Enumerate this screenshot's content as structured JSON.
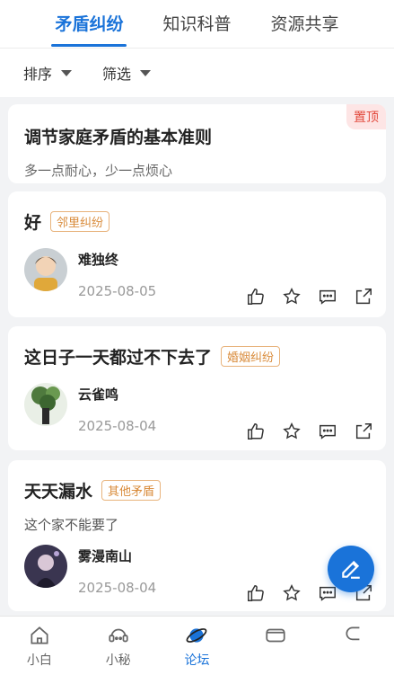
{
  "tabs": [
    {
      "label": "矛盾纠纷",
      "active": true
    },
    {
      "label": "知识科普",
      "active": false
    },
    {
      "label": "资源共享",
      "active": false
    }
  ],
  "filters": {
    "sort_label": "排序",
    "filter_label": "筛选"
  },
  "pinned": {
    "title": "调节家庭矛盾的基本准则",
    "subtitle": "多一点耐心，少一点烦心",
    "badge": "置顶"
  },
  "posts": [
    {
      "title": "好",
      "tag": "邻里纠纷",
      "body": "",
      "author": "难独终",
      "date": "2025-08-05"
    },
    {
      "title": "这日子一天都过不下去了",
      "tag": "婚姻纠纷",
      "body": "",
      "author": "云雀鸣",
      "date": "2025-08-04"
    },
    {
      "title": "天天漏水",
      "tag": "其他矛盾",
      "body": "这个家不能要了",
      "author": "雾漫南山",
      "date": "2025-08-04"
    }
  ],
  "bottom_nav": [
    {
      "label": "小白",
      "icon": "home-icon"
    },
    {
      "label": "小秘",
      "icon": "assistant-icon"
    },
    {
      "label": "论坛",
      "icon": "forum-icon",
      "active": true
    },
    {
      "label": "",
      "icon": "message-icon"
    },
    {
      "label": "",
      "icon": "profile-icon"
    }
  ],
  "colors": {
    "accent": "#1a73d9",
    "tag": "#d98b3a",
    "pin": "#e2493c"
  }
}
